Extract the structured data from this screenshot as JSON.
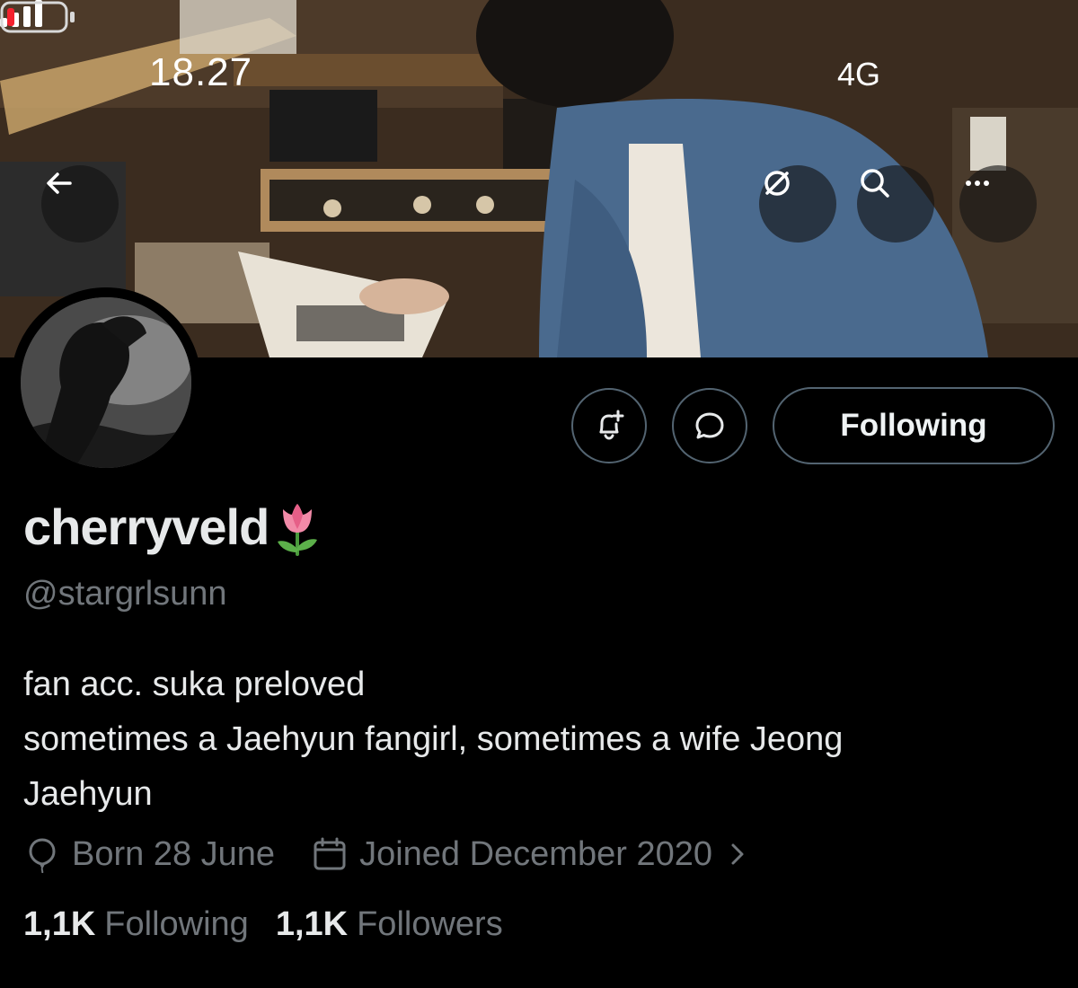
{
  "status_bar": {
    "time": "18.27",
    "network": "4G"
  },
  "banner": {
    "description_icons": [
      "back-arrow-icon",
      "translate-icon",
      "search-icon",
      "more-icon"
    ]
  },
  "actions": {
    "notify_icon": "bell-plus-icon",
    "message_icon": "message-bubble-icon",
    "following_label": "Following"
  },
  "profile": {
    "display_name": "cherryveld",
    "name_emoji": "tulip",
    "handle": "@stargrlsunn",
    "bio_lines": [
      "fan acc. suka preloved",
      "sometimes a Jaehyun fangirl, sometimes a wife Jeong",
      "Jaehyun"
    ],
    "birthday": "Born 28 June",
    "joined": "Joined December 2020"
  },
  "stats": {
    "following_count": "1,1K",
    "following_label": "Following",
    "followers_count": "1,1K",
    "followers_label": "Followers"
  },
  "colors": {
    "background": "#000000",
    "primary_text": "#e7e9ea",
    "secondary_text": "#71767b",
    "border": "#536471",
    "battery_low": "#f4212e"
  }
}
